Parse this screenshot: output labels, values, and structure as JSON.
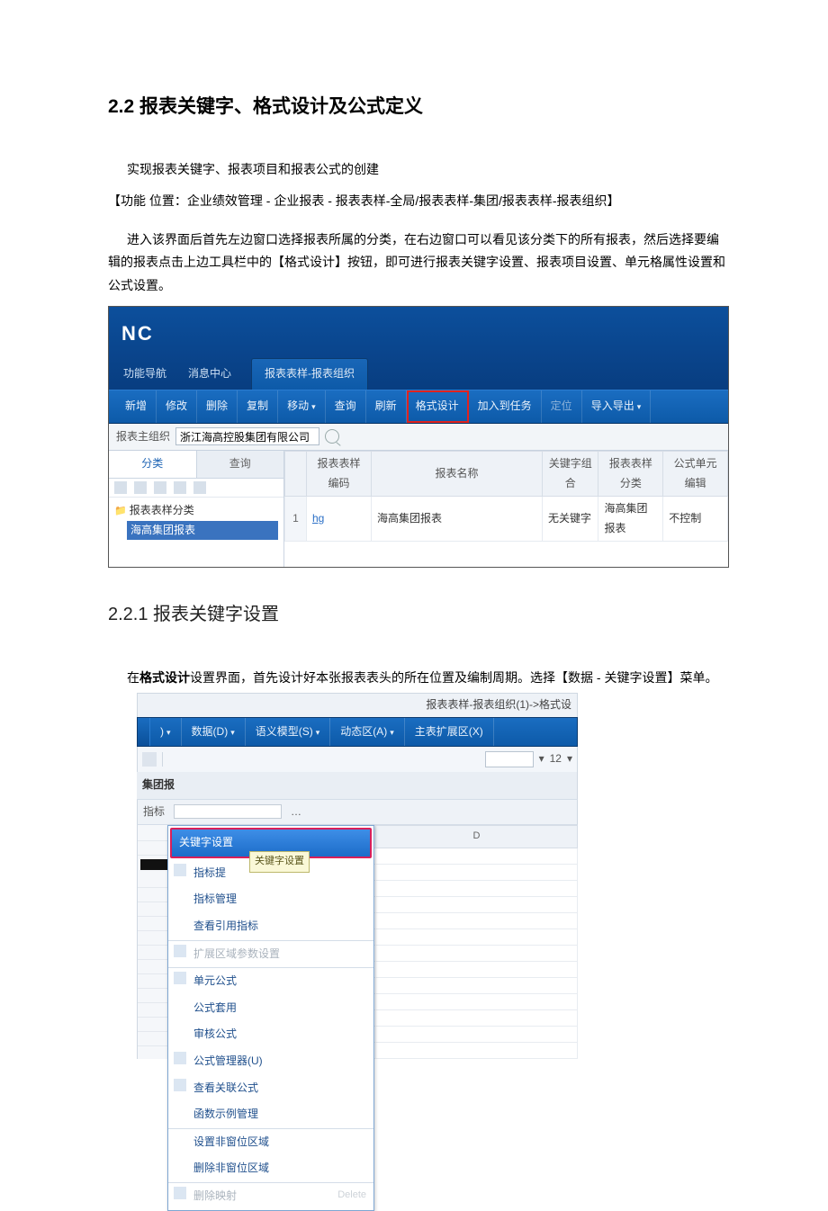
{
  "section": {
    "title": "2.2 报表关键字、格式设计及公式定义",
    "p1": "实现报表关键字、报表项目和报表公式的创建",
    "func": "【功能 位置：企业绩效管理 - 企业报表 - 报表表样-全局/报表表样-集团/报表表样-报表组织】",
    "p2": "进入该界面后首先左边窗口选择报表所属的分类，在右边窗口可以看见该分类下的所有报表，然后选择要编辑的报表点击上边工具栏中的【格式设计】按钮，即可进行报表关键字设置、报表项目设置、单元格属性设置和公式设置。"
  },
  "nc": {
    "logo": "NC",
    "tabs": {
      "t1": "功能导航",
      "t2": "消息中心",
      "active": "报表表样-报表组织"
    },
    "toolbar": [
      "新增",
      "修改",
      "删除",
      "复制",
      "移动",
      "查询",
      "刷新",
      "格式设计",
      "加入到任务",
      "定位",
      "导入导出"
    ],
    "toolbar_boxed_index": 7,
    "toolbar_disabled": [
      9
    ],
    "toolbar_dropdown": [
      4,
      10
    ],
    "filter_label": "报表主组织",
    "filter_value": "浙江海高控股集团有限公司",
    "left_tabs": {
      "a": "分类",
      "b": "查询"
    },
    "tree": {
      "root": "报表表样分类",
      "leaf": "海高集团报表"
    },
    "grid": {
      "cols": [
        "报表表样编码",
        "报表名称",
        "关键字组合",
        "报表表样分类",
        "公式单元编辑"
      ],
      "row": {
        "idx": "1",
        "code": "hg",
        "name": "海高集团报表",
        "key": "无关键字",
        "cat": "海高集团报表",
        "edit": "不控制"
      }
    }
  },
  "sub": {
    "title": "2.2.1 报表关键字设置",
    "p1a": "在",
    "p1b": "格式设计",
    "p1c": "设置界面，首先设计好本张报表表头的所在位置及编制周期。选择【数据 - 关键字设置】菜单。"
  },
  "menu": {
    "titlebar": "报表表样-报表组织(1)->格式设",
    "bar": [
      ")",
      "数据(D)",
      "语义模型(S)",
      "动态区(A)",
      "主表扩展区(X)"
    ],
    "bar_dropdown": [
      0,
      1,
      2,
      3
    ],
    "font_size": "12",
    "left_header": "集团报",
    "indicator_tab": "指标",
    "tooltip": "关键字设置",
    "items": [
      {
        "t": "关键字设置",
        "hl": true
      },
      {
        "t": "指标提",
        "ic": true
      },
      {
        "t": "指标管理"
      },
      {
        "t": "查看引用指标"
      },
      {
        "t": "扩展区域参数设置",
        "dis": true,
        "ic": true,
        "sep": true
      },
      {
        "t": "单元公式",
        "ic": true,
        "sep": true
      },
      {
        "t": "公式套用"
      },
      {
        "t": "审核公式"
      },
      {
        "t": "公式管理器(U)",
        "ic": true
      },
      {
        "t": "查看关联公式",
        "ic": true
      },
      {
        "t": "函数示例管理"
      },
      {
        "t": "设置非窗位区域",
        "sep": true
      },
      {
        "t": "删除非窗位区域"
      },
      {
        "t": "删除映射",
        "dis": true,
        "ic": true,
        "sep": true,
        "sh": "Delete"
      }
    ],
    "grid_cols": [
      "",
      "D"
    ]
  }
}
